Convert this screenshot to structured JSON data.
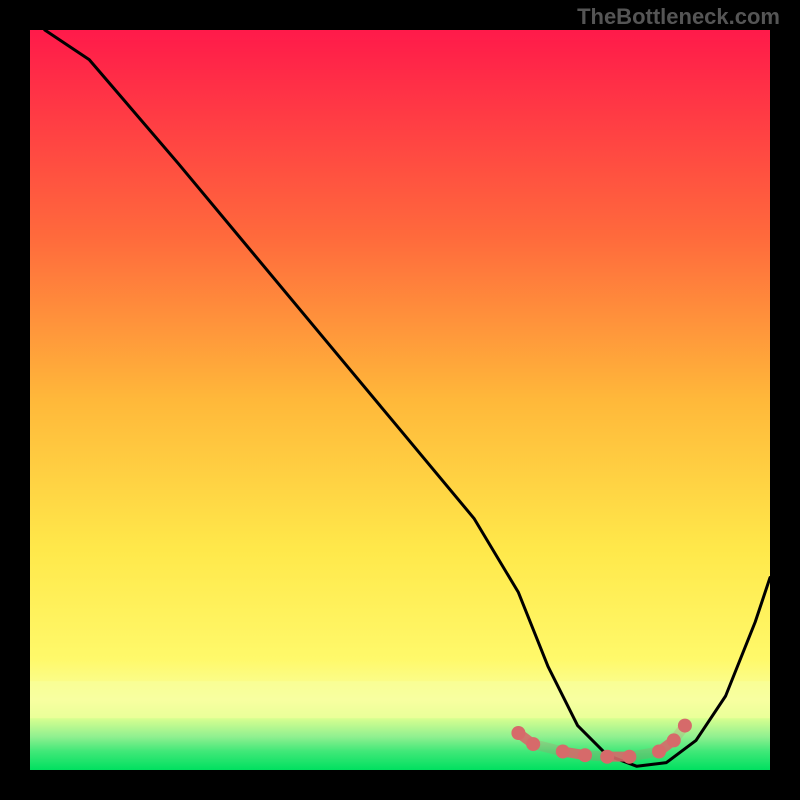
{
  "watermark": "TheBottleneck.com",
  "chart_data": {
    "type": "line",
    "title": "",
    "xlabel": "",
    "ylabel": "",
    "xlim": [
      0,
      100
    ],
    "ylim": [
      0,
      100
    ],
    "background_gradient": {
      "top": "#ff1a4a",
      "mid_upper": "#ff8040",
      "mid": "#ffd040",
      "mid_lower": "#ffff60",
      "band_yellow": "#f8ffa0",
      "bottom": "#00e060"
    },
    "series": [
      {
        "name": "bottleneck-curve",
        "color": "#000000",
        "x": [
          2,
          8,
          20,
          30,
          40,
          50,
          60,
          66,
          70,
          74,
          78,
          82,
          86,
          90,
          94,
          98,
          100
        ],
        "y": [
          100,
          96,
          82,
          70,
          58,
          46,
          34,
          24,
          14,
          6,
          2,
          0.5,
          1,
          4,
          10,
          20,
          26
        ]
      }
    ],
    "markers": {
      "name": "curve-dots",
      "color": "#d66a6a",
      "points": [
        {
          "x": 66,
          "y": 5
        },
        {
          "x": 68,
          "y": 3.5
        },
        {
          "x": 72,
          "y": 2.5
        },
        {
          "x": 75,
          "y": 2
        },
        {
          "x": 78,
          "y": 1.8
        },
        {
          "x": 81,
          "y": 1.8
        },
        {
          "x": 85,
          "y": 2.5
        },
        {
          "x": 87,
          "y": 4
        },
        {
          "x": 88.5,
          "y": 6
        }
      ]
    }
  }
}
